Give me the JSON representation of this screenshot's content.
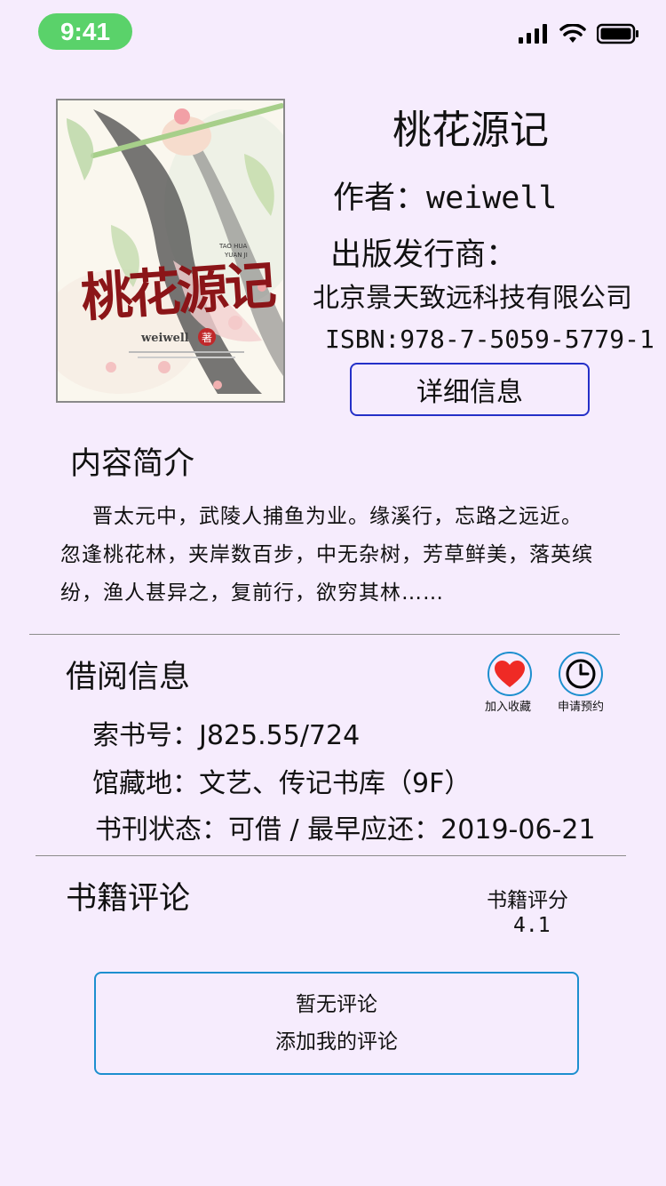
{
  "status_bar": {
    "time": "9:41"
  },
  "book": {
    "cover": {
      "title_art": "桃花源记",
      "pinyin_top": "TAO HUA",
      "pinyin_bottom": "YUAN JI",
      "author_art": "weiwell",
      "seal": "著"
    },
    "title": "桃花源记",
    "author_line": "作者：weiwell",
    "publisher_label": "出版发行商：",
    "publisher_name": "北京景天致远科技有限公司",
    "isbn_line": "ISBN:978-7-5059-5779-1",
    "detail_button": "详细信息"
  },
  "intro": {
    "heading": "内容简介",
    "text": "晋太元中，武陵人捕鱼为业。缘溪行，忘路之远近。忽逢桃花林，夹岸数百步，中无杂树，芳草鲜美，落英缤纷，渔人甚异之，复前行，欲穷其林……"
  },
  "borrow": {
    "heading": "借阅信息",
    "favorite_label": "加入收藏",
    "reserve_label": "申请预约",
    "call_number": "索书号：J825.55/724",
    "location": "馆藏地：文艺、传记书库（9F）",
    "status": "书刊状态：可借 / 最早应还：2019-06-21"
  },
  "review": {
    "heading": "书籍评论",
    "rating_label": "书籍评分",
    "rating_value": "4.1",
    "empty_text": "暂无评论",
    "add_link": "添加我的评论"
  },
  "colors": {
    "background": "#f6ecfd",
    "time_pill": "#5ad26a",
    "button_border": "#2430c8",
    "accent_blue": "#1d8fcf",
    "heart": "#ef2a25"
  }
}
